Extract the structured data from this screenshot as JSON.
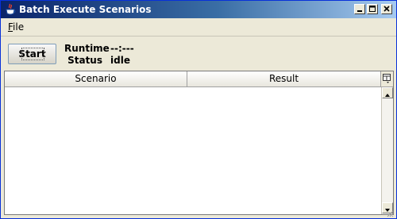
{
  "window": {
    "title": "Batch Execute Scenarios",
    "app_icon": "java-cup-icon",
    "controls": [
      "minimize-icon",
      "maximize-icon",
      "close-icon"
    ]
  },
  "menubar": {
    "file": {
      "mnemonic": "F",
      "rest": "ile"
    }
  },
  "toolbar": {
    "start_label": "Start"
  },
  "info": {
    "runtime_label": "Runtime",
    "runtime_value": "--:---",
    "status_label": "Status",
    "status_value": "idle"
  },
  "table": {
    "columns": [
      "Scenario",
      "Result"
    ],
    "rows": []
  }
}
